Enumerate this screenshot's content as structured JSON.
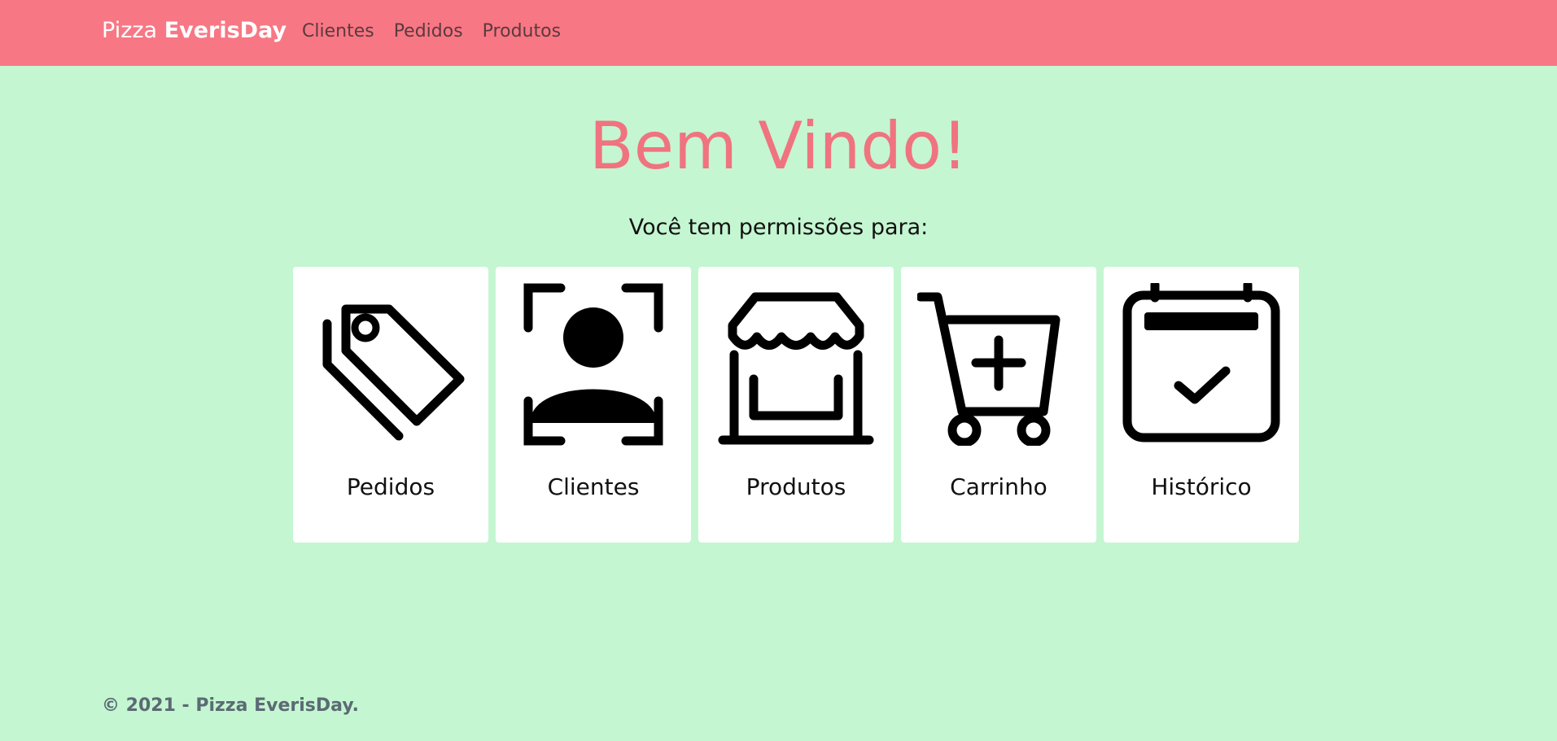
{
  "navbar": {
    "brand_prefix": "Pizza",
    "brand_bold": "EverisDay",
    "links": [
      {
        "label": "Clientes"
      },
      {
        "label": "Pedidos"
      },
      {
        "label": "Produtos"
      }
    ],
    "background": "#f87784"
  },
  "main": {
    "title": "Bem Vindo!",
    "subtitle": "Você tem permissões para:",
    "title_color": "#f07380",
    "background": "#c4f6d1",
    "cards": [
      {
        "label": "Pedidos",
        "icon": "tags-icon"
      },
      {
        "label": "Clientes",
        "icon": "person-bounding-box-icon"
      },
      {
        "label": "Produtos",
        "icon": "shop-icon"
      },
      {
        "label": "Carrinho",
        "icon": "cart-plus-icon"
      },
      {
        "label": "Histórico",
        "icon": "calendar-check-icon"
      }
    ]
  },
  "footer": {
    "text": "© 2021 - Pizza EverisDay."
  }
}
